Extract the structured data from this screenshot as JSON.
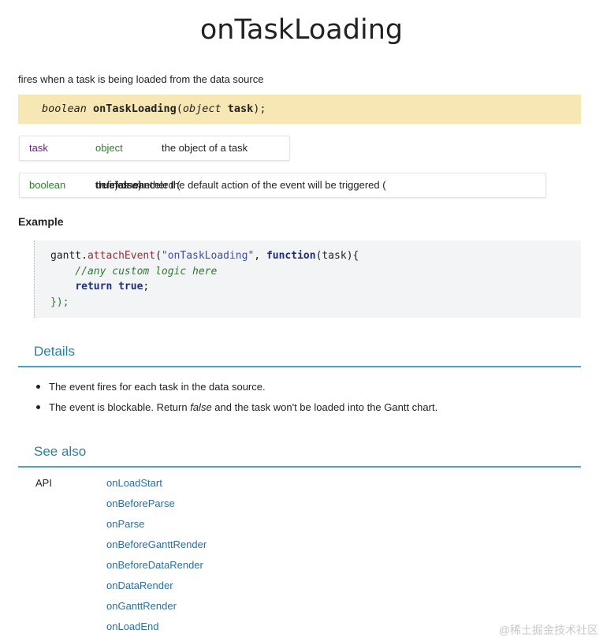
{
  "title": "onTaskLoading",
  "description": "fires when a task is being loaded from the data source",
  "signature": {
    "return_type": "boolean",
    "name": "onTaskLoading",
    "open": "(",
    "param_type": "object",
    "param_name": "task",
    "close": ");"
  },
  "params": [
    {
      "name": "task",
      "type": "object",
      "description": "the object of a task"
    }
  ],
  "returns": {
    "type": "boolean",
    "description_pre": "defines whether the default action of the event will be triggered (",
    "true_text": "true",
    "description_mid": ") or canceled (",
    "false_text": "false",
    "description_post": ")"
  },
  "example": {
    "heading": "Example",
    "line1": {
      "obj": "gantt.",
      "method": "attachEvent",
      "open": "(",
      "str": "\"onTaskLoading\"",
      "comma": ", ",
      "kw": "function",
      "args": "(task){"
    },
    "line2": "    //any custom logic here",
    "line3": {
      "indent": "    ",
      "kw": "return",
      "val": " true",
      "semi": ";"
    },
    "line4": "});"
  },
  "details": {
    "heading": "Details",
    "items": [
      {
        "pre": "The event fires for each task in the data source.",
        "em": "",
        "post": ""
      },
      {
        "pre": "The event is blockable. Return ",
        "em": "false",
        "post": " and the task won't be loaded into the Gantt chart."
      }
    ]
  },
  "see_also": {
    "heading": "See also",
    "label": "API",
    "links": [
      "onLoadStart",
      "onBeforeParse",
      "onParse",
      "onBeforeGanttRender",
      "onBeforeDataRender",
      "onDataRender",
      "onGanttRender",
      "onLoadEnd"
    ]
  },
  "watermark": "@稀土掘金技术社区"
}
